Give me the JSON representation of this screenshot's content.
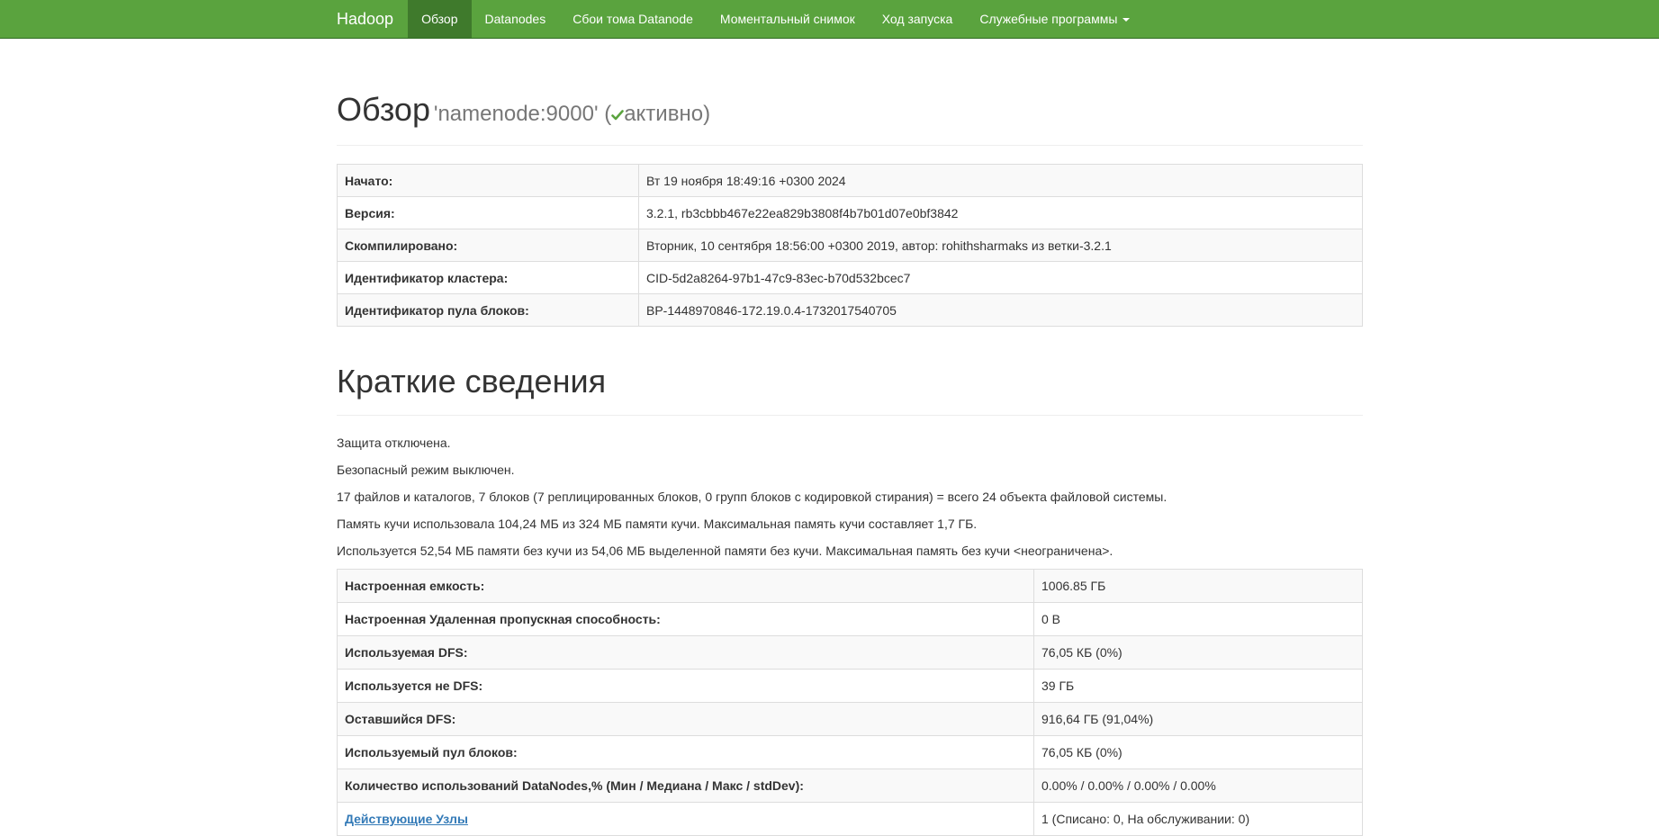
{
  "navbar": {
    "brand": "Hadoop",
    "items": [
      {
        "label": "Обзор",
        "active": true
      },
      {
        "label": "Datanodes"
      },
      {
        "label": "Сбои тома Datanode"
      },
      {
        "label": "Моментальный снимок"
      },
      {
        "label": "Ход запуска"
      },
      {
        "label": "Служебные программы",
        "dropdown": true
      }
    ]
  },
  "overview": {
    "title": "Обзор",
    "subtitle_prefix": "'namenode:9000' (",
    "status": "активно",
    "subtitle_suffix": ")",
    "status_color": "#5aa33e",
    "rows": [
      {
        "key": "Начато:",
        "value": "Вт 19 ноября 18:49:16 +0300 2024"
      },
      {
        "key": "Версия:",
        "value": "3.2.1, rb3cbbb467e22ea829b3808f4b7b01d07e0bf3842"
      },
      {
        "key": "Скомпилировано:",
        "value": "Вторник, 10 сентября 18:56:00 +0300 2019, автор: rohithsharmaks из ветки-3.2.1"
      },
      {
        "key": "Идентификатор кластера:",
        "value": "CID-5d2a8264-97b1-47c9-83ec-b70d532bcec7"
      },
      {
        "key": "Идентификатор пула блоков:",
        "value": "BP-1448970846-172.19.0.4-1732017540705"
      }
    ]
  },
  "summary": {
    "title": "Краткие сведения",
    "lines": [
      "Защита отключена.",
      "Безопасный режим выключен.",
      "17 файлов и каталогов, 7 блоков (7 реплицированных блоков, 0 групп блоков с кодировкой стирания) = всего 24 объекта файловой системы.",
      "Память кучи использовала 104,24 МБ из 324 МБ памяти кучи. Максимальная память кучи составляет 1,7 ГБ.",
      "Используется 52,54 МБ памяти без кучи из 54,06 МБ выделенной памяти без кучи. Максимальная память без кучи <неограничена>."
    ],
    "rows": [
      {
        "key": "Настроенная емкость:",
        "value": "1006.85 ГБ"
      },
      {
        "key": "Настроенная Удаленная пропускная способность:",
        "value": "0 B"
      },
      {
        "key": "Используемая DFS:",
        "value": "76,05 КБ (0%)"
      },
      {
        "key": "Используется не DFS:",
        "value": "39 ГБ"
      },
      {
        "key": "Оставшийся DFS:",
        "value": "916,64 ГБ (91,04%)"
      },
      {
        "key": "Используемый пул блоков:",
        "value": "76,05 КБ (0%)"
      },
      {
        "key": "Количество использований DataNodes,% (Мин / Медиана / Макс / stdDev):",
        "value": "0.00% / 0.00% / 0.00% / 0.00%"
      },
      {
        "key": "Действующие Узлы",
        "value": "1 (Списано: 0, На обслуживании: 0)",
        "link": true
      }
    ]
  }
}
